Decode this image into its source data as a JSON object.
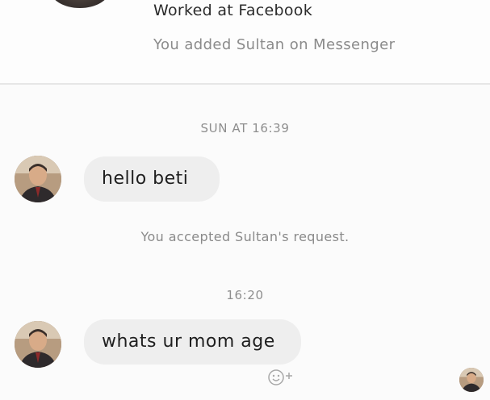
{
  "profile": {
    "work": "Worked at Facebook",
    "added_note": "You added Sultan on Messenger"
  },
  "conversation": {
    "timestamp_1": "SUN AT 16:39",
    "message_1": "hello beti",
    "system_message": "You accepted Sultan's request.",
    "timestamp_2": "16:20",
    "message_2": "whats ur mom age"
  },
  "colors": {
    "background": "#fbfbfb",
    "bubble": "#eeeeee",
    "meta_text": "#8e8e8e"
  },
  "icons": {
    "reaction": "add-reaction-icon",
    "avatar": "sender-avatar"
  }
}
